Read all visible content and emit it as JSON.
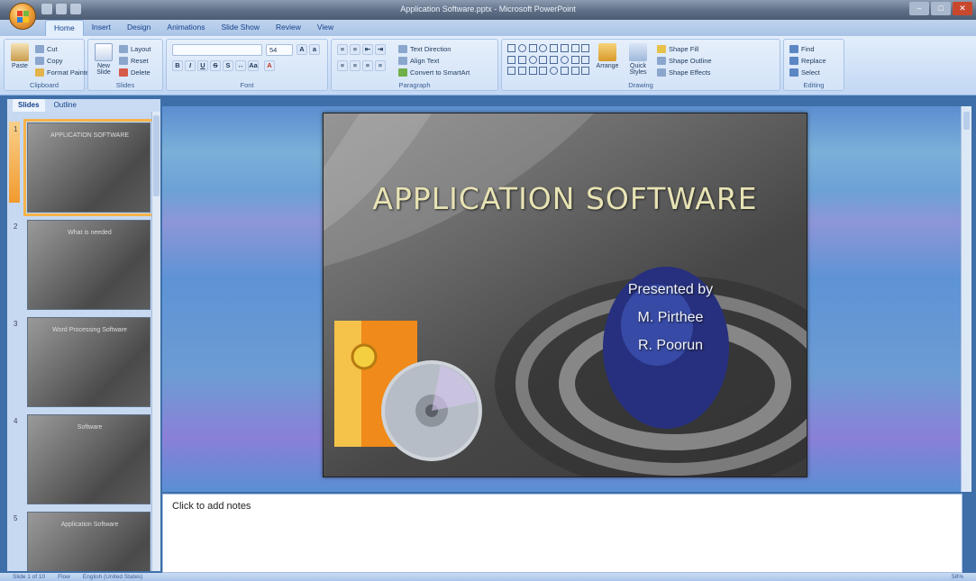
{
  "window": {
    "title": "Application Software.pptx - Microsoft PowerPoint",
    "controls": [
      "–",
      "□",
      "✕"
    ]
  },
  "ribbon": {
    "tabs": [
      "Home",
      "Insert",
      "Design",
      "Animations",
      "Slide Show",
      "Review",
      "View"
    ],
    "active_tab": "Home",
    "clipboard": {
      "label": "Clipboard",
      "paste": "Paste",
      "cut": "Cut",
      "copy": "Copy",
      "format_painter": "Format Painter"
    },
    "slides": {
      "label": "Slides",
      "new_slide": "New Slide",
      "layout": "Layout",
      "reset": "Reset",
      "delete": "Delete"
    },
    "font": {
      "label": "Font",
      "font_name": "",
      "font_size": "54"
    },
    "paragraph": {
      "label": "Paragraph",
      "text_direction": "Text Direction",
      "align_text": "Align Text",
      "smartart": "Convert to SmartArt"
    },
    "drawing": {
      "label": "Drawing",
      "arrange": "Arrange",
      "quick_styles": "Quick Styles",
      "shape_fill": "Shape Fill",
      "shape_outline": "Shape Outline",
      "shape_effects": "Shape Effects"
    },
    "editing": {
      "label": "Editing",
      "find": "Find",
      "replace": "Replace",
      "select": "Select"
    }
  },
  "left_panel": {
    "tabs": [
      "Slides",
      "Outline"
    ],
    "active_tab": "Slides",
    "thumbnails": [
      {
        "num": "1",
        "title": "APPLICATION SOFTWARE"
      },
      {
        "num": "2",
        "title": "What is needed"
      },
      {
        "num": "3",
        "title": "Word Processing Software"
      },
      {
        "num": "4",
        "title": "Software"
      },
      {
        "num": "5",
        "title": "Application Software"
      }
    ]
  },
  "slide": {
    "title": "APPLICATION SOFTWARE",
    "presented_by": "Presented by",
    "presenter_1": "M. Pirthee",
    "presenter_2": "R. Poorun"
  },
  "notes": {
    "placeholder": "Click to add notes"
  },
  "status": {
    "slide_info": "Slide 1 of 10",
    "theme": "Flow",
    "language": "English (United States)",
    "zoom": "58%"
  },
  "colors": {
    "ribbon_bg": "#dbe7f8",
    "accent": "#f29a2e",
    "slide_title": "#e8e3b4"
  }
}
